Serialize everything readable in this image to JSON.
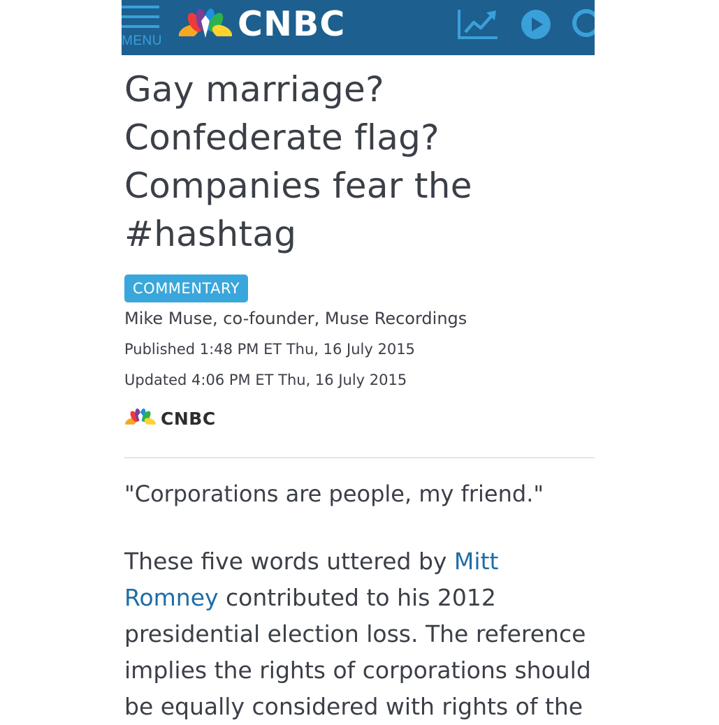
{
  "header": {
    "menu_label": "MENU",
    "brand": "CNBC",
    "brand_bg": "#1d5f8f",
    "icon_color": "#3aa0d9",
    "icons": [
      "menu-icon",
      "peacock-logo-icon",
      "chart-icon",
      "play-icon",
      "search-icon"
    ]
  },
  "article": {
    "headline_lines": [
      "Gay marriage?",
      "Confederate flag?",
      "Companies fear the",
      "#hashtag"
    ],
    "badge": "COMMENTARY",
    "badge_color": "#3aa7dc",
    "author": "Mike Muse, co-founder, Muse Recordings",
    "published": "Published 1:48 PM ET Thu, 16 July 2015",
    "updated": "Updated 4:06 PM ET Thu, 16 July 2015",
    "source_brand": "CNBC",
    "quote": "\"Corporations are people, my friend.\"",
    "body": {
      "lines": [
        {
          "pre": "These five words uttered by ",
          "link": "Mitt",
          "post": ""
        },
        {
          "pre": "",
          "link": "Romney",
          "post": " contributed to his 2012"
        },
        {
          "pre": "presidential election loss. The reference",
          "link": "",
          "post": ""
        },
        {
          "pre": "implies the rights of corporations should",
          "link": "",
          "post": ""
        },
        {
          "pre": "be equally considered with rights of the",
          "link": "",
          "post": ""
        }
      ],
      "link_color": "#1f6da6"
    }
  }
}
